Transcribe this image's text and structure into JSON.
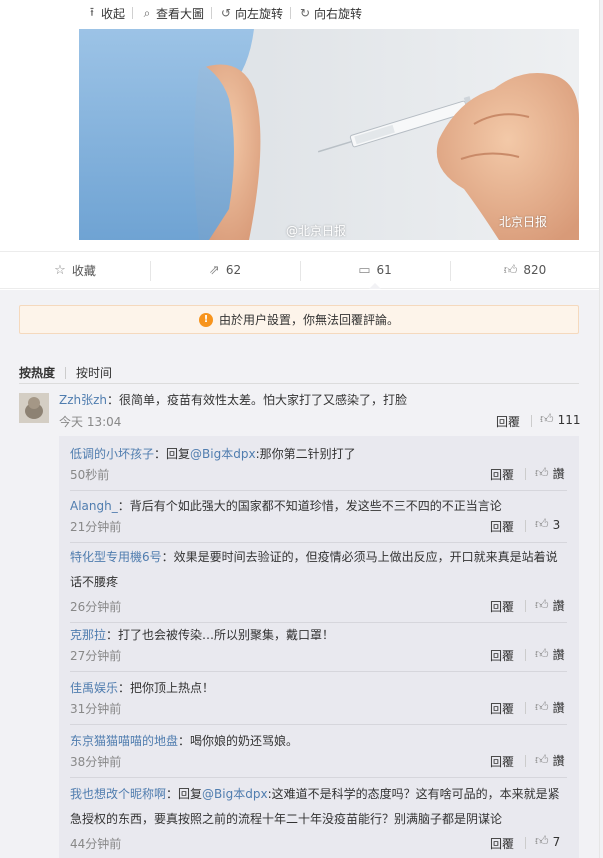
{
  "toolbar": {
    "collapse": "收起",
    "view_large": "查看大圖",
    "rotate_left": "向左旋转",
    "rotate_right": "向右旋转"
  },
  "photo": {
    "watermark_left": "@北京日报",
    "watermark_right": "北京日报"
  },
  "actions": {
    "favorite": "收藏",
    "repost_count": "62",
    "comment_count": "61",
    "like_count": "820"
  },
  "notice": {
    "text": "由於用户設置，你無法回覆評論。"
  },
  "sort": {
    "hot": "按热度",
    "time": "按时间"
  },
  "main_comment": {
    "user": "Zzh张zh",
    "text": "：很简单，疫苗有效性太差。怕大家打了又感染了，打脸",
    "time": "今天 13:04",
    "reply_label": "回覆",
    "likes": "111"
  },
  "replies": [
    {
      "user": "低调的小坏孩子",
      "text": "：回复",
      "mention": "@Big本dpx",
      "text2": ":那你第二针别打了",
      "text_line2": "",
      "time": "50秒前",
      "reply_label": "回覆",
      "likes": "讚"
    },
    {
      "user": "Alangh_",
      "text": "：背后有个如此强大的国家都不知道珍惜，发这些不三不四的不正当言论",
      "mention": "",
      "text2": "",
      "text_line2": "",
      "time": "21分钟前",
      "reply_label": "回覆",
      "likes": "3"
    },
    {
      "user": "特化型专用機6号",
      "text": "：效果是要时间去验证的，但疫情必须马上做出反应，开口就来真是站着说",
      "mention": "",
      "text2": "",
      "text_line2": "话不腰疼",
      "time": "26分钟前",
      "reply_label": "回覆",
      "likes": "讚"
    },
    {
      "user": "克那拉",
      "text": "：打了也会被传染…所以别聚集，戴口罩！",
      "mention": "",
      "text2": "",
      "text_line2": "",
      "time": "27分钟前",
      "reply_label": "回覆",
      "likes": "讚"
    },
    {
      "user": "佳禹娱乐",
      "text": "：把你顶上热点！",
      "mention": "",
      "text2": "",
      "text_line2": "",
      "time": "31分钟前",
      "reply_label": "回覆",
      "likes": "讚"
    },
    {
      "user": "东京猫猫喵喵的地盘",
      "text": "：喝你娘的奶还骂娘。",
      "mention": "",
      "text2": "",
      "text_line2": "",
      "time": "38分钟前",
      "reply_label": "回覆",
      "likes": "讚"
    },
    {
      "user": "我也想改个昵称啊",
      "text": "：回复",
      "mention": "@Big本dpx",
      "text2": ":这难道不是科学的态度吗？这有啥可品的，本来就是紧",
      "text_line2": "急授权的东西，要真按照之前的流程十年二十年没疫苗能行？别满脑子都是阴谋论",
      "time": "44分钟前",
      "reply_label": "回覆",
      "likes": "7"
    }
  ],
  "colors": {
    "accent": "#eb7350",
    "link": "#507daf",
    "notice_bg": "#fdf4ea",
    "warn": "#f7941d"
  }
}
